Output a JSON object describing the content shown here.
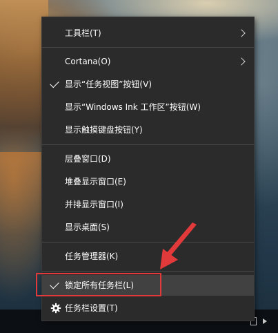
{
  "menu": {
    "items": [
      {
        "label": "工具栏(T)",
        "checked": false,
        "submenu": true,
        "icon": null,
        "highlighted": false
      },
      {
        "label": "Cortana(O)",
        "checked": false,
        "submenu": true,
        "icon": null,
        "highlighted": false
      },
      {
        "label": "显示“任务视图”按钮(V)",
        "checked": true,
        "submenu": false,
        "icon": "check-icon",
        "highlighted": false
      },
      {
        "label": "显示“Windows Ink 工作区”按钮(W)",
        "checked": false,
        "submenu": false,
        "icon": null,
        "highlighted": false
      },
      {
        "label": "显示触摸键盘按钮(Y)",
        "checked": false,
        "submenu": false,
        "icon": null,
        "highlighted": false
      },
      {
        "label": "层叠窗口(D)",
        "checked": false,
        "submenu": false,
        "icon": null,
        "highlighted": false
      },
      {
        "label": "堆叠显示窗口(E)",
        "checked": false,
        "submenu": false,
        "icon": null,
        "highlighted": false
      },
      {
        "label": "并排显示窗口(I)",
        "checked": false,
        "submenu": false,
        "icon": null,
        "highlighted": false
      },
      {
        "label": "显示桌面(S)",
        "checked": false,
        "submenu": false,
        "icon": null,
        "highlighted": false
      },
      {
        "label": "任务管理器(K)",
        "checked": false,
        "submenu": false,
        "icon": null,
        "highlighted": false
      },
      {
        "label": "锁定所有任务栏(L)",
        "checked": true,
        "submenu": false,
        "icon": "check-icon",
        "highlighted": true
      },
      {
        "label": "任务栏设置(T)",
        "checked": false,
        "submenu": false,
        "icon": "gear-icon",
        "highlighted": false
      }
    ]
  },
  "annotation": {
    "box_color": "#e23a3a",
    "arrow_color": "#e23a3a"
  },
  "colors": {
    "menu_bg": "#2b2b2b",
    "highlight_bg": "#414141",
    "separator": "#4a4a4a",
    "text": "#ffffff"
  }
}
